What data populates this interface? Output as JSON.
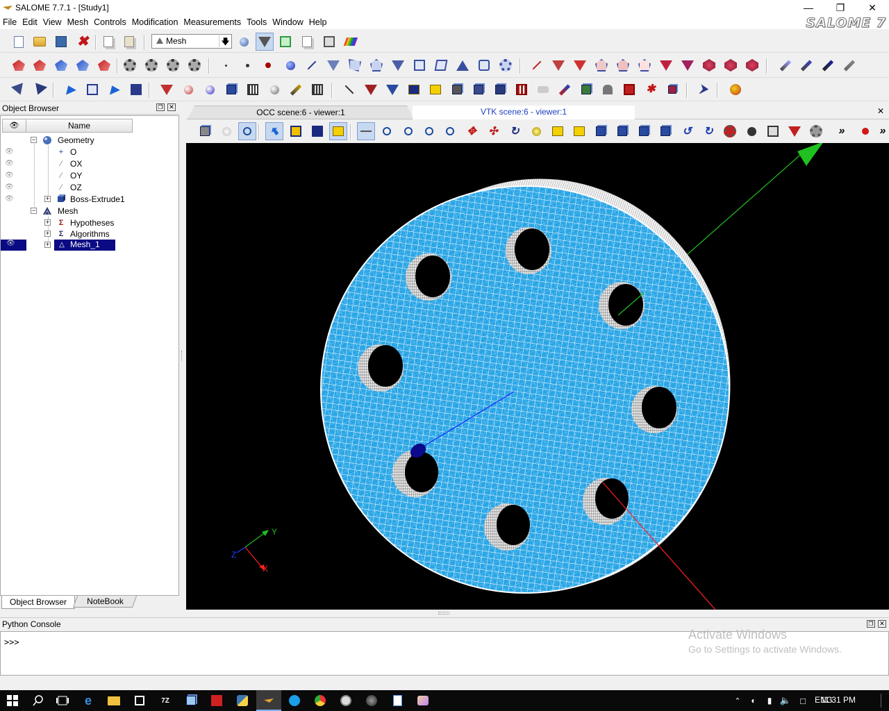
{
  "app": {
    "window_title": "SALOME 7.7.1 - [Study1]",
    "brand": "SALOME 7"
  },
  "menu": [
    "File",
    "Edit",
    "View",
    "Mesh",
    "Controls",
    "Modification",
    "Measurements",
    "Tools",
    "Window",
    "Help"
  ],
  "module_selector": {
    "value": "Mesh"
  },
  "object_browser": {
    "title": "Object Browser",
    "header_name": "Name",
    "tree": [
      {
        "label": "Geometry",
        "level": 0,
        "expanded": true,
        "icon": "geometry-icon"
      },
      {
        "label": "O",
        "level": 1,
        "icon": "point-icon",
        "visible": true
      },
      {
        "label": "OX",
        "level": 1,
        "icon": "vector-icon",
        "visible": true
      },
      {
        "label": "OY",
        "level": 1,
        "icon": "vector-icon",
        "visible": true
      },
      {
        "label": "OZ",
        "level": 1,
        "icon": "vector-icon",
        "visible": true
      },
      {
        "label": "Boss-Extrude1",
        "level": 1,
        "icon": "solid-icon",
        "visible": true
      },
      {
        "label": "Mesh",
        "level": 0,
        "expanded": true,
        "icon": "mesh-module-icon"
      },
      {
        "label": "Hypotheses",
        "level": 1,
        "icon": "hypotheses-icon"
      },
      {
        "label": "Algorithms",
        "level": 1,
        "icon": "algorithms-icon"
      },
      {
        "label": "Mesh_1",
        "level": 1,
        "icon": "mesh-icon",
        "selected": true
      }
    ],
    "tabs": [
      "Object Browser",
      "NoteBook"
    ]
  },
  "viewer": {
    "tabs": [
      "OCC scene:6 - viewer:1",
      "VTK scene:6 - viewer:1"
    ],
    "active_tab": 1,
    "overflow": "»"
  },
  "console": {
    "title": "Python Console",
    "prompt": ">>>"
  },
  "watermark": {
    "line1": "Activate Windows",
    "line2": "Go to Settings to activate Windows."
  },
  "taskbar": {
    "language": "ENG",
    "time": "11:31 PM"
  },
  "colors": {
    "mesh_fill": "#2aa6e6",
    "mesh_edge": "#ffffff",
    "viewport_bg": "#000000",
    "selection": "#0a0a84",
    "axis_x": "#ff2020",
    "axis_y": "#20c020",
    "axis_z": "#2040ff"
  }
}
